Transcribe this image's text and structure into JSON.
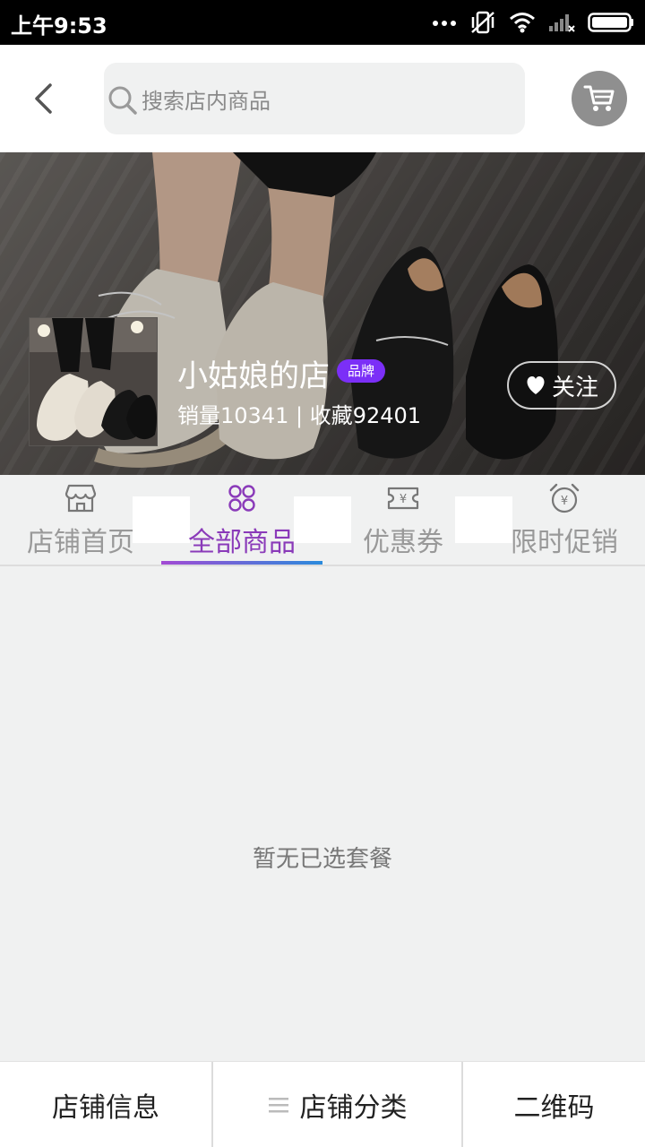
{
  "status_bar": {
    "time": "上午9:53"
  },
  "header": {
    "search_placeholder": "搜索店内商品"
  },
  "shop": {
    "name": "小姑娘的店",
    "badge": "品牌",
    "stats": "销量10341 | 收藏92401",
    "follow_label": "关注"
  },
  "tabs": [
    {
      "label": "店铺首页",
      "icon": "storefront-icon",
      "active": false
    },
    {
      "label": "全部商品",
      "icon": "grid-icon",
      "active": true
    },
    {
      "label": "优惠券",
      "icon": "coupon-icon",
      "active": false
    },
    {
      "label": "限时促销",
      "icon": "alarm-clock-icon",
      "active": false
    }
  ],
  "content": {
    "empty_text": "暂无已选套餐"
  },
  "bottom_bar": {
    "items": [
      {
        "label": "店铺信息"
      },
      {
        "label": "店铺分类",
        "icon": "menu-lines-icon"
      },
      {
        "label": "二维码"
      }
    ]
  },
  "colors": {
    "accent": "#8a3ab9",
    "badge": "#7b2ff7",
    "background": "#f0f1f1"
  }
}
